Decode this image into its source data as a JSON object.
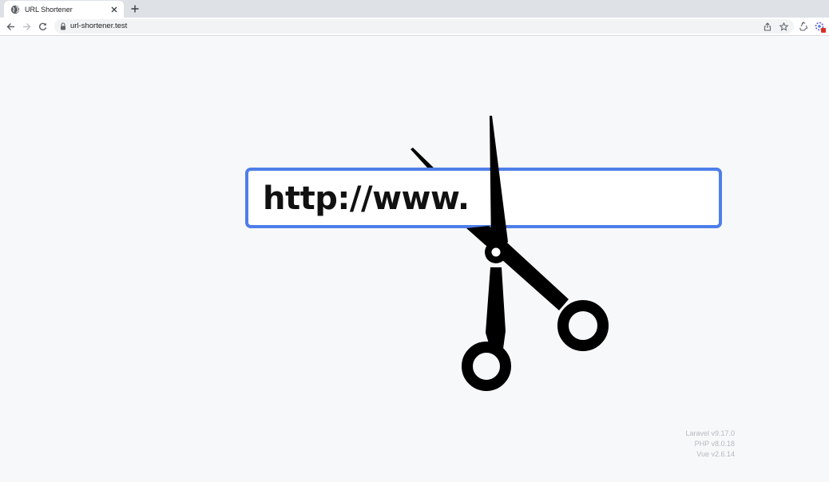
{
  "browser": {
    "tab": {
      "title": "URL Shortener",
      "favicon": "globe-icon",
      "close_icon": "close-icon"
    },
    "new_tab_icon": "plus-icon",
    "nav": {
      "back_icon": "back-arrow-icon",
      "forward_icon": "forward-arrow-icon",
      "reload_icon": "reload-icon"
    },
    "address_bar": {
      "url": "url-shortener.test",
      "lock_icon": "lock-icon",
      "share_icon": "share-icon",
      "bookmark_icon": "star-icon"
    },
    "extensions": {
      "recycle_icon": "recycle-icon",
      "extension_icon": "extension-icon"
    }
  },
  "hero": {
    "url_text": "http://www.",
    "illustration": "scissors-icon",
    "accent_color": "#4e7ee8"
  },
  "footer": {
    "versions": [
      "Laravel v9.17.0",
      "PHP v8.0.18",
      "Vue v2.6.14"
    ]
  }
}
